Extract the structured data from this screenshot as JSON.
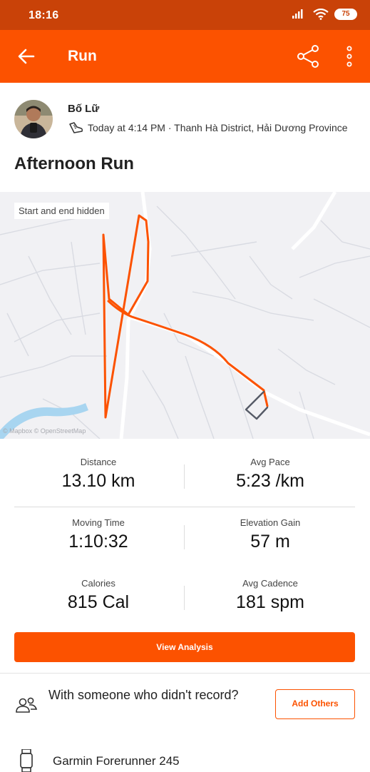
{
  "status_bar": {
    "time": "18:16",
    "battery": "75"
  },
  "app_bar": {
    "title": "Run"
  },
  "header": {
    "athlete_name": "Bố Lữ",
    "meta": "Today at 4:14 PM · Thanh Hà District, Hải Dương Province",
    "activity_title": "Afternoon Run"
  },
  "map": {
    "privacy_chip": "Start and end hidden",
    "attribution": "© Mapbox © OpenStreetMap",
    "route_color": "#fc5200"
  },
  "stats": [
    {
      "label": "Distance",
      "value": "13.10 km"
    },
    {
      "label": "Avg Pace",
      "value": "5:23 /km"
    },
    {
      "label": "Moving Time",
      "value": "1:10:32"
    },
    {
      "label": "Elevation Gain",
      "value": "57 m"
    },
    {
      "label": "Calories",
      "value": "815 Cal"
    },
    {
      "label": "Avg Cadence",
      "value": "181 spm"
    }
  ],
  "actions": {
    "view_analysis": "View Analysis"
  },
  "group": {
    "text": "With someone who didn't record?",
    "button": "Add Others"
  },
  "device": {
    "name": "Garmin Forerunner 245"
  },
  "colors": {
    "brand": "#fc5200",
    "status_bar": "#c94208"
  }
}
